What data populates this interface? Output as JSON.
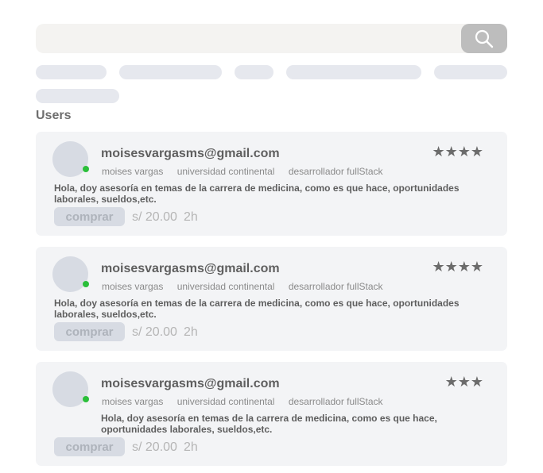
{
  "search": {
    "placeholder": "",
    "icon": "search-icon"
  },
  "section_title": "Users",
  "users": [
    {
      "email": "moisesvargasms@gmail.com",
      "name": "moises vargas",
      "university": "universidad continental",
      "role": "desarrollador fullStack",
      "stars": "★★★★",
      "rating": 4,
      "description": "Hola, doy asesoría en temas de la carrera de medicina, como es que hace, oportunidades laborales, sueldos,etc.",
      "buy_label": "comprar",
      "price": "s/ 20.00",
      "duration": "2h",
      "online": true
    },
    {
      "email": "moisesvargasms@gmail.com",
      "name": "moises vargas",
      "university": "universidad continental",
      "role": "desarrollador fullStack",
      "stars": "★★★★",
      "rating": 4,
      "description": "Hola, doy asesoría en temas de la carrera de medicina, como es que hace, oportunidades laborales, sueldos,etc.",
      "buy_label": "comprar",
      "price": "s/ 20.00",
      "duration": "2h",
      "online": true
    },
    {
      "email": "moisesvargasms@gmail.com",
      "name": "moises vargas",
      "university": "universidad continental",
      "role": "desarrollador fullStack",
      "stars": "★★★",
      "rating": 3,
      "description": "Hola, doy asesoría en temas de la carrera de medicina, como es que hace, oportunidades laborales, sueldos,etc.",
      "buy_label": "comprar",
      "price": "s/ 20.00",
      "duration": "2h",
      "online": true
    }
  ],
  "colors": {
    "online": "#2bbf3a",
    "card_bg": "#f3f4f6",
    "search_button": "#bdbdbd"
  }
}
